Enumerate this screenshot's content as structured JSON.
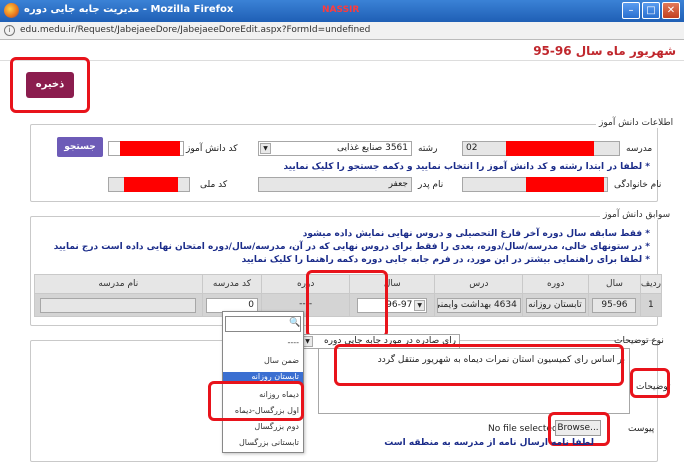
{
  "window": {
    "title": "مدیریت جابه جایی دوره - Mozilla Firefox",
    "tag": "NASSIR",
    "url": "edu.medu.ir/Request/JabejaeeDore/JabejaeeDoreEdit.aspx?FormId=undefined"
  },
  "page": {
    "title": "شهریور ماه سال 96-95"
  },
  "toolbar": {
    "save_label": "ذخیره"
  },
  "student": {
    "legend": "اطلاعات دانش آموز",
    "school_label": "مدرسه",
    "school_value": "02",
    "major_label": "رشته",
    "major_value": "3561 صنایع غذایی",
    "student_code_label": "کد دانش آموز",
    "search_label": "جستجو",
    "note": "* لطفا در ابتدا رشته و کد دانش آموز را انتخاب نمایید و دکمه جستجو را کلیک نمایید",
    "family_label": "نام خانوادگی",
    "father_label": "نام پدر",
    "father_value": "جعفر",
    "national_code_label": "کد ملی"
  },
  "history": {
    "legend": "سوابق دانش آموز",
    "notes": [
      "* فقط سابقه سال دوره آخر فارغ التحصیلی و دروس نهایی نمایش داده میشود",
      "* در ستونهای خالی، مدرسه/سال/دوره، بعدی را فقط برای دروس نهایی که در آن، مدرسه/سال/دوره امتحان نهایی داده است درج نمایید",
      "* لطفا برای راهنمایی بیشتر در این مورد، در فرم جابه جایی دوره دکمه راهنما را کلیک نمایید"
    ],
    "columns": [
      "ردیف",
      "سال",
      "دوره",
      "درس",
      "سال",
      "دوره",
      "کد مدرسه",
      "نام مدرسه"
    ],
    "row": {
      "index": "1",
      "year": "95-96",
      "period": "تابستان روزانه",
      "course": "4634 بهداشت وایمنی کا",
      "new_year": "96-97",
      "new_period": "----",
      "school_code": "0",
      "school_name": ""
    }
  },
  "dropdown": {
    "options": [
      "----",
      "ضمن سال",
      "تابستان روزانه",
      "دیماه روزانه",
      "اول بزرگسال-دیماه",
      "دوم بزرگسال",
      "تابستانی بزرگسال"
    ],
    "highlighted": "تابستان روزانه"
  },
  "extra": {
    "type_label": "نوع توضیحات",
    "type_value": "رای صادره در مورد جابه جایی دوره",
    "desc_label": "توضیحات",
    "desc_value": "بر اساس رای کمیسیون استان نمرات دیماه به شهریور منتقل گردد",
    "attachment_label": "پیوست",
    "file_status": "No file selected.",
    "browse_label": "Browse...",
    "attachment_note": "لطفا نامه ارسال نامه از مدرسه به منطقه است"
  },
  "colors": {
    "accent": "#8b1d4e",
    "search": "#6d5bb7",
    "note": "#1b2c8a",
    "highlight": "#e8131b"
  }
}
